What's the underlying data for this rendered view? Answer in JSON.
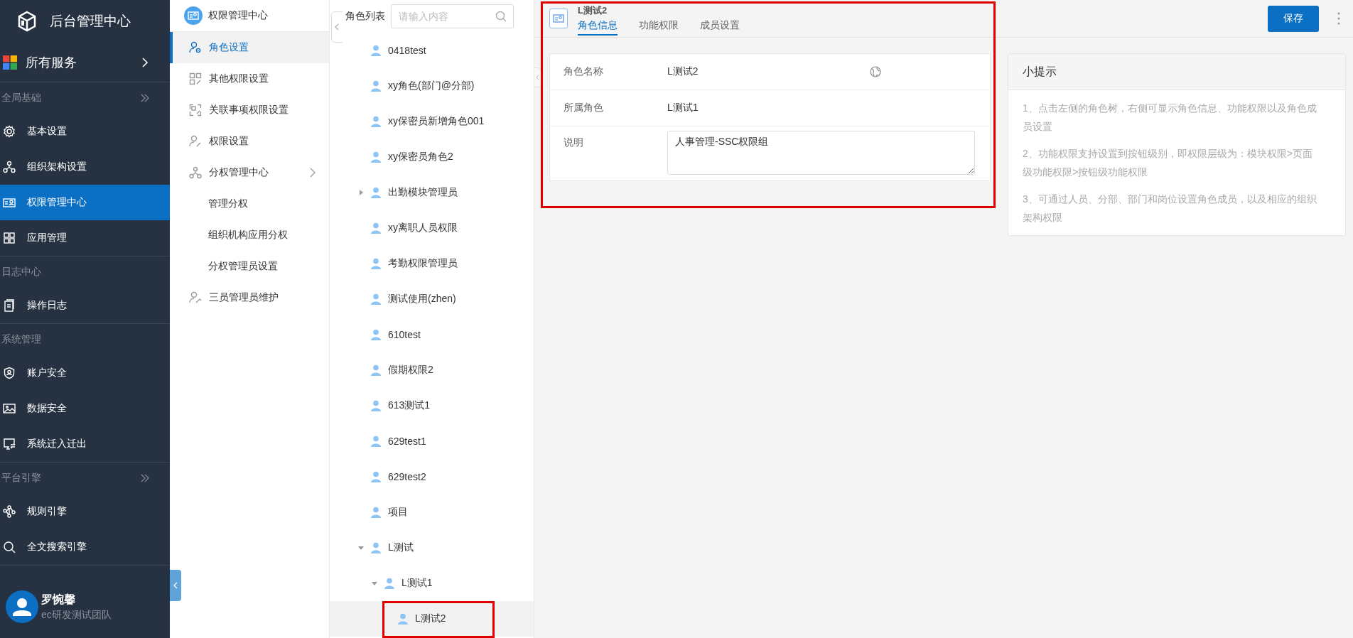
{
  "app": {
    "title": "后台管理中心"
  },
  "all_services": {
    "label": "所有服务"
  },
  "nav_sections": [
    {
      "label": "全局基础",
      "has_toggle": true,
      "items": [
        {
          "label": "基本设置",
          "selected": false
        },
        {
          "label": "组织架构设置",
          "selected": false
        },
        {
          "label": "权限管理中心",
          "selected": true
        },
        {
          "label": "应用管理",
          "selected": false
        }
      ]
    },
    {
      "label": "日志中心",
      "has_toggle": false,
      "items": [
        {
          "label": "操作日志",
          "selected": false
        }
      ]
    },
    {
      "label": "系统管理",
      "has_toggle": false,
      "items": [
        {
          "label": "账户安全",
          "selected": false
        },
        {
          "label": "数据安全",
          "selected": false
        },
        {
          "label": "系统迁入迁出",
          "selected": false
        }
      ]
    },
    {
      "label": "平台引擎",
      "has_toggle": true,
      "items": [
        {
          "label": "规则引擎",
          "selected": false
        },
        {
          "label": "全文搜索引擎",
          "selected": false
        }
      ]
    }
  ],
  "user": {
    "name": "罗惋馨",
    "team": "ec研发测试团队"
  },
  "sub_nav": {
    "title": "权限管理中心",
    "items": [
      {
        "label": "角色设置",
        "selected": true
      },
      {
        "label": "其他权限设置",
        "selected": false
      },
      {
        "label": "关联事项权限设置",
        "selected": false
      },
      {
        "label": "权限设置",
        "selected": false
      },
      {
        "label": "分权管理中心",
        "selected": false,
        "expanded": true,
        "children": [
          {
            "label": "管理分权",
            "selected": false
          },
          {
            "label": "组织机构应用分权",
            "selected": false
          },
          {
            "label": "分权管理员设置",
            "selected": false
          }
        ]
      },
      {
        "label": "三员管理员维护",
        "selected": false
      }
    ]
  },
  "role_tree": {
    "title": "角色列表",
    "search": {
      "placeholder": "请输入内容"
    },
    "nodes": [
      {
        "label": "0418test",
        "selected": false
      },
      {
        "label": "xy角色(部门@分部)",
        "selected": false
      },
      {
        "label": "xy保密员新增角色001",
        "selected": false
      },
      {
        "label": "xy保密员角色2",
        "selected": false
      },
      {
        "label": "出勤模块管理员",
        "selected": false,
        "expanded": false
      },
      {
        "label": "xy离职人员权限",
        "selected": false
      },
      {
        "label": "考勤权限管理员",
        "selected": false
      },
      {
        "label": "测试使用(zhen)",
        "selected": false
      },
      {
        "label": "610test",
        "selected": false
      },
      {
        "label": "假期权限2",
        "selected": false
      },
      {
        "label": "613测试1",
        "selected": false
      },
      {
        "label": "629test1",
        "selected": false
      },
      {
        "label": "629test2",
        "selected": false
      },
      {
        "label": "项目",
        "selected": false
      },
      {
        "label": "L测试",
        "selected": false,
        "expanded": true,
        "children": [
          {
            "label": "L测试1",
            "selected": false,
            "expanded": true,
            "children": [
              {
                "label": "L测试2",
                "selected": true
              }
            ]
          }
        ]
      }
    ]
  },
  "detail": {
    "title": "L测试2",
    "tabs": [
      {
        "label": "角色信息",
        "selected": true
      },
      {
        "label": "功能权限",
        "selected": false
      },
      {
        "label": "成员设置",
        "selected": false
      }
    ],
    "save_button": "保存",
    "form": [
      {
        "kind": "text_globe",
        "label": "角色名称",
        "value": "L测试2"
      },
      {
        "kind": "text",
        "label": "所属角色",
        "value": "L测试1"
      },
      {
        "kind": "textarea",
        "label": "说明",
        "value": "人事管理-SSC权限组"
      }
    ]
  },
  "tips": {
    "title": "小提示",
    "items": [
      "1、点击左侧的角色树，右侧可显示角色信息、功能权限以及角色成员设置",
      "2、功能权限支持设置到按钮级别，即权限层级为：模块权限>页面级功能权限>按钮级功能权限",
      "3、可通过人员、分部、部门和岗位设置角色成员，以及相应的组织架构权限"
    ]
  }
}
